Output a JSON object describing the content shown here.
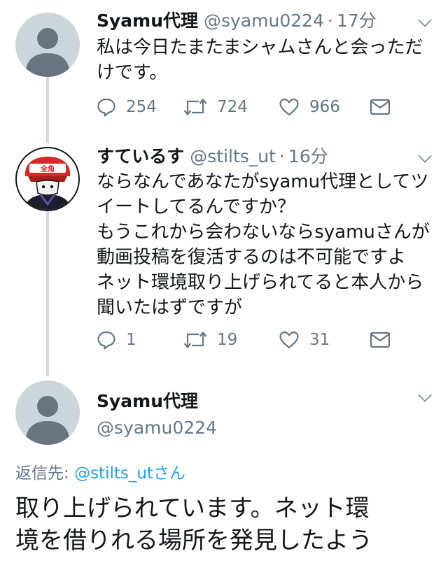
{
  "tweets": [
    {
      "display_name": "Syamu代理",
      "handle": "@syamu0224",
      "separator": "·",
      "time": "17分",
      "avatar": "default-avatar-icon",
      "text_lines": [
        "私は今日たまたまシャムさんと会っただ",
        "けです。"
      ],
      "reply_count": "254",
      "retweet_count": "724",
      "like_count": "966"
    },
    {
      "display_name": "すているす",
      "handle": "@stilts_ut",
      "separator": "·",
      "time": "16分",
      "avatar": "character-avatar-icon",
      "avatar_badge": "全角",
      "text_lines": [
        "ならなんであなたがsyamu代理としてツ",
        "イートしてるんですか？",
        "もうこれから会わないならsyamuさんが",
        "動画投稿を復活するのは不可能ですよ",
        "ネット環境取り上げられてると本人から",
        "聞いたはずですが"
      ],
      "reply_count": "1",
      "retweet_count": "19",
      "like_count": "31"
    }
  ],
  "main_tweet": {
    "display_name": "Syamu代理",
    "handle": "@syamu0224",
    "avatar": "default-avatar-icon",
    "reply_to_label": "返信先: ",
    "reply_to_user": "@stilts_utさん",
    "text_lines": [
      "取り上げられています。ネット環",
      "境を借りれる場所を発見したよう"
    ]
  },
  "colors": {
    "text_primary": "#14171a",
    "text_secondary": "#657786",
    "link": "#1da1f2",
    "thread_line": "#cfd9de",
    "avatar_default_bg": "#ccd6dd",
    "avatar_default_fg": "#68757f"
  }
}
